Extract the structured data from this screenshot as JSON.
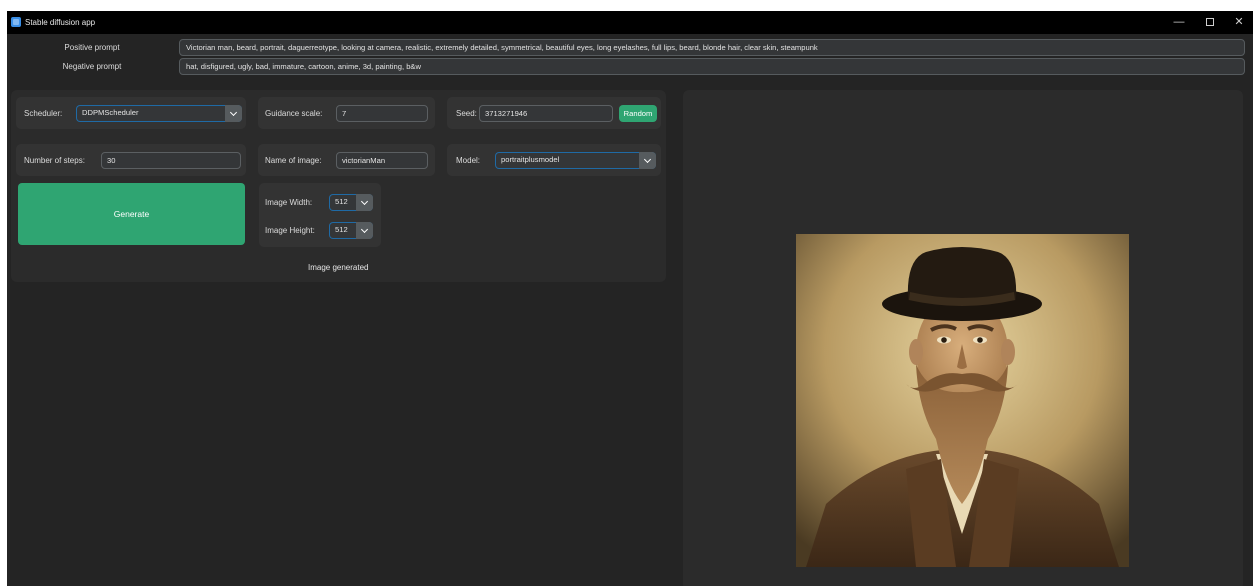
{
  "window": {
    "title": "Stable diffusion app",
    "minimize_glyph": "—",
    "close_glyph": "✕"
  },
  "prompts": {
    "positive_label": "Positive prompt",
    "positive_value": "Victorian man, beard, portrait, daguerreotype, looking at camera, realistic, extremely detailed, symmetrical, beautiful eyes, long eyelashes, full lips, beard, blonde hair, clear skin, steampunk",
    "negative_label": "Negative prompt",
    "negative_value": "hat, disfigured, ugly, bad, immature, cartoon, anime, 3d, painting, b&w"
  },
  "settings": {
    "scheduler_label": "Scheduler:",
    "scheduler_value": "DDPMScheduler",
    "guidance_label": "Guidance scale:",
    "guidance_value": "7",
    "seed_label": "Seed:",
    "seed_value": "3713271946",
    "random_label": "Random",
    "steps_label": "Number of steps:",
    "steps_value": "30",
    "name_label": "Name of image:",
    "name_value": "victorianMan",
    "model_label": "Model:",
    "model_value": "portraitplusmodel",
    "width_label": "Image Width:",
    "width_value": "512",
    "height_label": "Image Height:",
    "height_value": "512"
  },
  "generate_label": "Generate",
  "status_text": "Image generated",
  "icons": {
    "app": "app-icon",
    "dropdown": "chevron-down-icon"
  },
  "colors": {
    "accent_green": "#2fa572",
    "accent_blue": "#1f6aa5",
    "background": "#242424",
    "panel": "#2b2b2b"
  }
}
